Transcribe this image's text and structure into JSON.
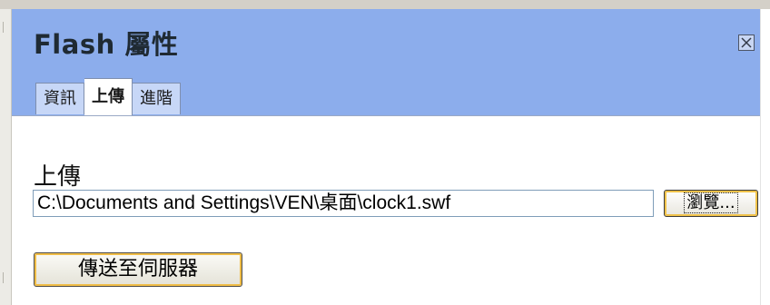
{
  "dialog": {
    "title": "Flash 屬性",
    "close_icon": "close-x-icon"
  },
  "tabs": [
    {
      "label": "資訊",
      "active": false
    },
    {
      "label": "上傳",
      "active": true
    },
    {
      "label": "進階",
      "active": false
    }
  ],
  "upload": {
    "section_label": "上傳",
    "file_path": "C:\\Documents and Settings\\VEN\\桌面\\clock1.swf",
    "browse_label": "瀏覽...",
    "send_label": "傳送至伺服器"
  },
  "colors": {
    "header_bg": "#8cadec",
    "tab_bg": "#c7d7f7",
    "button_focus": "#f0bd47"
  }
}
